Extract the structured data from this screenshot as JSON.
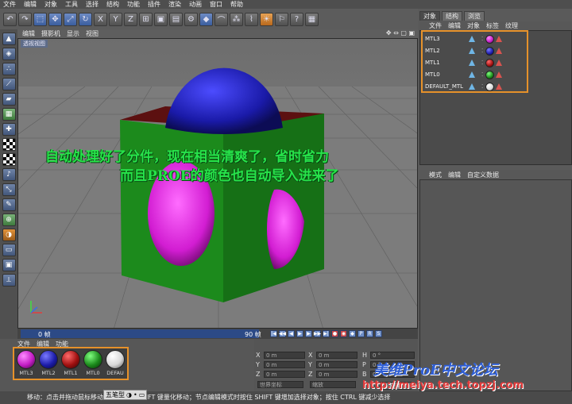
{
  "menubar": [
    "文件",
    "编辑",
    "对象",
    "工具",
    "选择",
    "结构",
    "功能",
    "插件",
    "渲染",
    "动画",
    "窗口",
    "帮助"
  ],
  "viewport": {
    "menu": [
      "编辑",
      "摄影机",
      "显示",
      "视图"
    ],
    "title": "透视视图",
    "overlay_line1": "自动处理好了分件，现在相当清爽了，省时省力",
    "overlay_line2": "而且PROE的颜色也自动导入进来了"
  },
  "timeline": {
    "start": "0 帧",
    "end": "90 帧"
  },
  "material_manager": {
    "menu": [
      "文件",
      "编辑",
      "功能"
    ],
    "materials": [
      {
        "label": "MTL3",
        "color": "#c21dc4"
      },
      {
        "label": "MTL2",
        "color": "#1c1ca8"
      },
      {
        "label": "MTL1",
        "color": "#a01010"
      },
      {
        "label": "MTL0",
        "color": "#1c8a1c"
      },
      {
        "label": "DEFAU",
        "color": "#e6e6e6"
      }
    ]
  },
  "coordinates": {
    "rows": [
      {
        "a": "X",
        "a_val": "0 m",
        "b": "X",
        "b_val": "0 m",
        "c": "H",
        "c_val": "0 °"
      },
      {
        "a": "Y",
        "a_val": "0 m",
        "b": "Y",
        "b_val": "0 m",
        "c": "P",
        "c_val": "0 °"
      },
      {
        "a": "Z",
        "a_val": "0 m",
        "b": "Z",
        "b_val": "0 m",
        "c": "B",
        "c_val": "0 °"
      }
    ],
    "world_label": "世界坐标",
    "scale_label": "缩放",
    "apply": "应用"
  },
  "status": "移动：点击并拖动鼠标移动元素。按住 SHIFT 键量化移动；节点编辑模式时按住 SHIFT 键增加选择对象；按住 CTRL 键减少选择",
  "ime": {
    "name": "五笔型"
  },
  "right_panel": {
    "tabs": [
      "对象",
      "结构",
      "浏览"
    ],
    "menu": [
      "文件",
      "编辑",
      "对象",
      "标签",
      "纹理"
    ],
    "objects": [
      {
        "name": "MTL3",
        "color": "#c21dc4"
      },
      {
        "name": "MTL2",
        "color": "#1c1ca8"
      },
      {
        "name": "MTL1",
        "color": "#a01010"
      },
      {
        "name": "MTL0",
        "color": "#1c8a1c"
      },
      {
        "name": "DEFAULT_MTL",
        "color": "#e6e6e6"
      }
    ],
    "attr_menu": [
      "模式",
      "编辑",
      "自定义数据"
    ]
  },
  "watermark": {
    "line1": "美维ProE中文论坛",
    "line2": "http://meiya.tech.topzj.com"
  },
  "colors": {
    "accent_orange": "#e6912a",
    "overlay_text": "#27e34a",
    "cube_green": "#1b8a1b",
    "sphere_blue": "#1a1aa8",
    "sphere_magenta": "#d21dd2"
  }
}
